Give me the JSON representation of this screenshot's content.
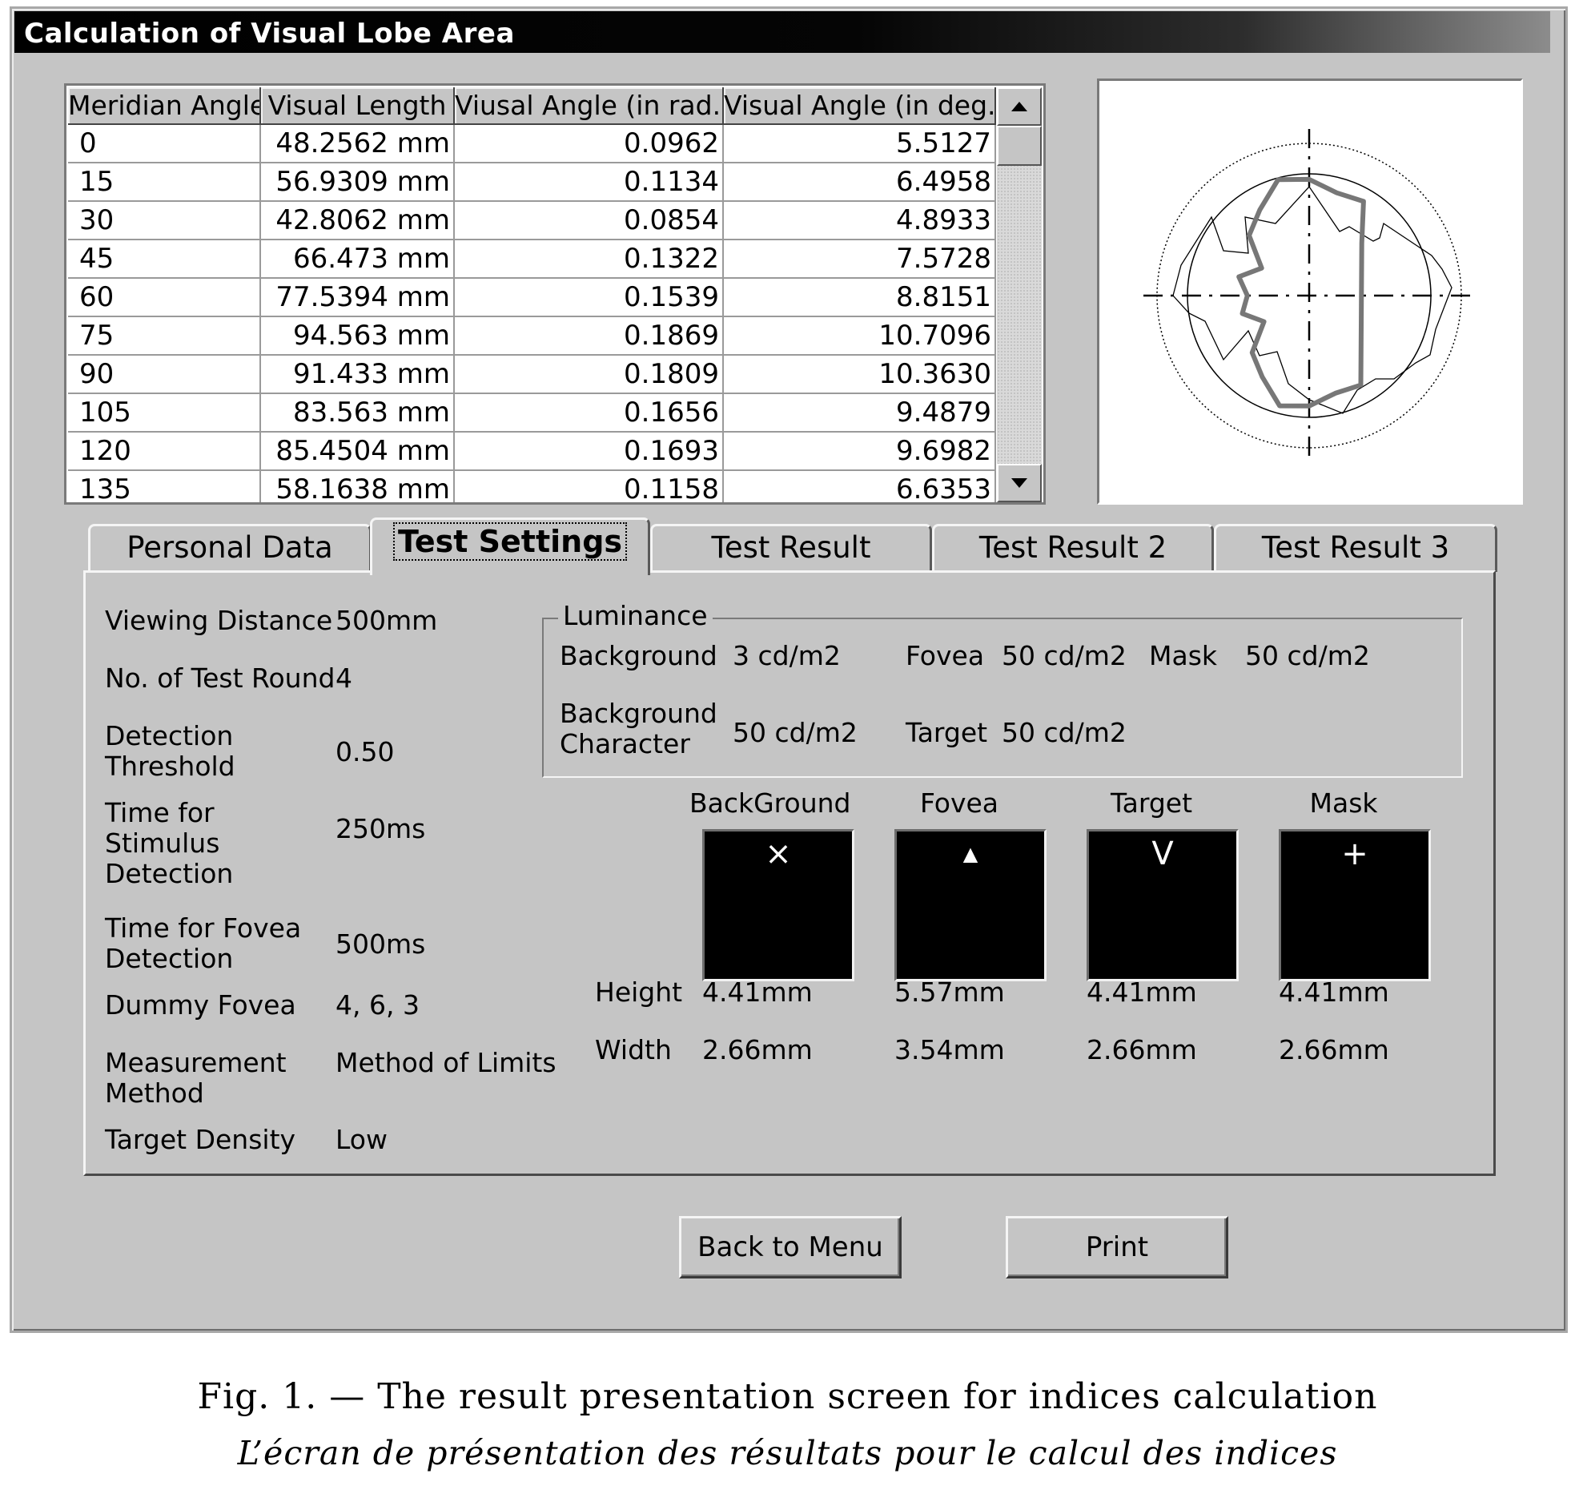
{
  "window": {
    "title": "Calculation of Visual Lobe Area"
  },
  "table": {
    "columns": [
      "Meridian Angle",
      "Visual Length",
      "Viusal Angle (in rad.)",
      "Visual Angle (in deg.)"
    ],
    "rows": [
      [
        "0",
        "48.2562 mm",
        "0.0962",
        "5.5127"
      ],
      [
        "15",
        "56.9309 mm",
        "0.1134",
        "6.4958"
      ],
      [
        "30",
        "42.8062 mm",
        "0.0854",
        "4.8933"
      ],
      [
        "45",
        "66.473 mm",
        "0.1322",
        "7.5728"
      ],
      [
        "60",
        "77.5394 mm",
        "0.1539",
        "8.8151"
      ],
      [
        "75",
        "94.563 mm",
        "0.1869",
        "10.7096"
      ],
      [
        "90",
        "91.433 mm",
        "0.1809",
        "10.3630"
      ],
      [
        "105",
        "83.563 mm",
        "0.1656",
        "9.4879"
      ],
      [
        "120",
        "85.4504 mm",
        "0.1693",
        "9.6982"
      ],
      [
        "135",
        "58.1638 mm",
        "0.1158",
        "6.6353"
      ]
    ]
  },
  "tabs": [
    {
      "label": "Personal Data",
      "active": false
    },
    {
      "label": "Test Settings",
      "active": true
    },
    {
      "label": "Test Result",
      "active": false
    },
    {
      "label": "Test Result 2",
      "active": false
    },
    {
      "label": "Test Result 3",
      "active": false
    }
  ],
  "settings": {
    "viewing_distance_label": "Viewing Distance",
    "viewing_distance": "500mm",
    "test_round_label": "No. of Test Round",
    "test_round": "4",
    "detection_threshold_label_1": "Detection",
    "detection_threshold_label_2": "Threshold",
    "detection_threshold": "0.50",
    "stimulus_time_label_1": "Time for",
    "stimulus_time_label_2": "Stimulus",
    "stimulus_time_label_3": "Detection",
    "stimulus_time": "250ms",
    "fovea_time_label_1": "Time for Fovea",
    "fovea_time_label_2": "Detection",
    "fovea_time": "500ms",
    "dummy_fovea_label": "Dummy Fovea",
    "dummy_fovea": "4, 6, 3",
    "measurement_method_label_1": "Measurement",
    "measurement_method_label_2": "Method",
    "measurement_method": "Method of Limits",
    "target_density_label": "Target Density",
    "target_density": "Low"
  },
  "luminance": {
    "title": "Luminance",
    "background_label": "Background",
    "background": "3 cd/m2",
    "fovea_label": "Fovea",
    "fovea": "50 cd/m2",
    "mask_label": "Mask",
    "mask": "50 cd/m2",
    "bg_char_label_1": "Background",
    "bg_char_label_2": "Character",
    "bg_char": "50 cd/m2",
    "target_label": "Target",
    "target": "50 cd/m2"
  },
  "stimuli": {
    "height_label": "Height",
    "width_label": "Width",
    "items": [
      {
        "name": "BackGround",
        "glyph": "×",
        "height": "4.41mm",
        "width": "2.66mm",
        "icon": "x-cross-icon"
      },
      {
        "name": "Fovea",
        "glyph": "▲",
        "height": "5.57mm",
        "width": "3.54mm",
        "icon": "triangle-icon"
      },
      {
        "name": "Target",
        "glyph": "V",
        "height": "4.41mm",
        "width": "2.66mm",
        "icon": "v-letter-icon"
      },
      {
        "name": "Mask",
        "glyph": "+",
        "height": "4.41mm",
        "width": "2.66mm",
        "icon": "plus-icon"
      }
    ]
  },
  "buttons": {
    "back": "Back to Menu",
    "print": "Print"
  },
  "caption": {
    "line1": "Fig. 1. — The result presentation screen for indices calculation",
    "line2": "L’écran de présentation des résultats pour le calcul des indices"
  },
  "colors": {
    "face": "#c5c5c5",
    "title_bar": "#000000",
    "plot_stroke": "#777777"
  }
}
